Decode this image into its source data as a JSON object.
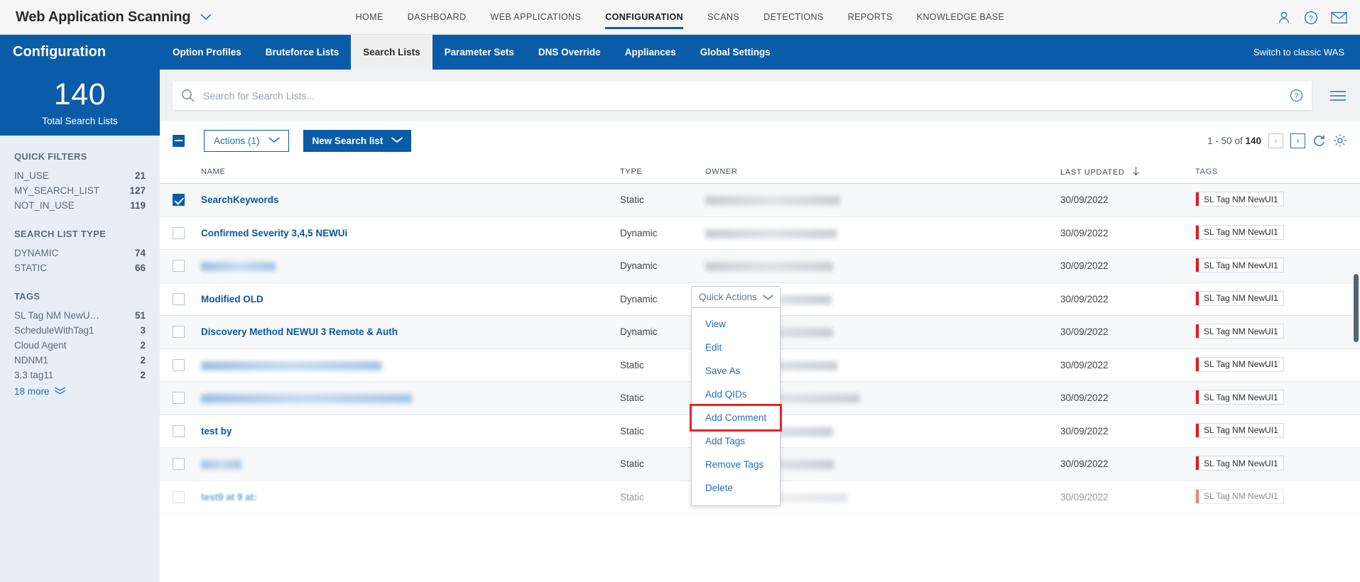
{
  "topbar": {
    "module_title": "Web Application Scanning",
    "module_caret": "chevron-down-icon",
    "nav": [
      {
        "label": "HOME",
        "active": false
      },
      {
        "label": "DASHBOARD",
        "active": false
      },
      {
        "label": "WEB APPLICATIONS",
        "active": false
      },
      {
        "label": "CONFIGURATION",
        "active": true
      },
      {
        "label": "SCANS",
        "active": false
      },
      {
        "label": "DETECTIONS",
        "active": false
      },
      {
        "label": "REPORTS",
        "active": false
      },
      {
        "label": "KNOWLEDGE BASE",
        "active": false
      }
    ],
    "icons": [
      "user-icon",
      "help-icon",
      "mail-icon"
    ]
  },
  "bluebar": {
    "section_title": "Configuration",
    "tabs": [
      {
        "label": "Option Profiles",
        "active": false
      },
      {
        "label": "Bruteforce Lists",
        "active": false
      },
      {
        "label": "Search Lists",
        "active": true
      },
      {
        "label": "Parameter Sets",
        "active": false
      },
      {
        "label": "DNS Override",
        "active": false
      },
      {
        "label": "Appliances",
        "active": false
      },
      {
        "label": "Global Settings",
        "active": false
      }
    ],
    "switch_classic": "Switch to classic WAS"
  },
  "sidebar": {
    "kpi_number": "140",
    "kpi_label": "Total Search Lists",
    "facets": [
      {
        "title": "QUICK FILTERS",
        "rows": [
          {
            "label": "IN_USE",
            "count": "21"
          },
          {
            "label": "MY_SEARCH_LIST",
            "count": "127"
          },
          {
            "label": "NOT_IN_USE",
            "count": "119"
          }
        ]
      },
      {
        "title": "SEARCH LIST TYPE",
        "rows": [
          {
            "label": "DYNAMIC",
            "count": "74"
          },
          {
            "label": "STATIC",
            "count": "66"
          }
        ]
      },
      {
        "title": "TAGS",
        "rows": [
          {
            "label": "SL Tag NM NewU…",
            "count": "51"
          },
          {
            "label": "ScheduleWithTag1",
            "count": "3"
          },
          {
            "label": "Cloud Agent",
            "count": "2"
          },
          {
            "label": "NDNM1",
            "count": "2"
          },
          {
            "label": "3.3 tag11",
            "count": "2"
          }
        ],
        "more_label": "18 more"
      }
    ]
  },
  "search": {
    "placeholder": "Search for Search Lists...",
    "value": "",
    "icon": "search-icon",
    "help_icon": "help-icon",
    "menu_icon": "hamburger-icon"
  },
  "toolbar": {
    "select_all": "indeterminate-checkbox",
    "actions_label": "Actions (1)",
    "new_label": "New Search list",
    "pager_text_prefix": "1 - 50 of ",
    "pager_total": "140",
    "prev_icon": "chevron-left-icon",
    "next_icon": "chevron-right-icon",
    "refresh_icon": "refresh-icon",
    "settings_icon": "gear-icon"
  },
  "table": {
    "columns": [
      "NAME",
      "TYPE",
      "OWNER",
      "LAST UPDATED",
      "TAGS"
    ],
    "sort_column": "LAST UPDATED",
    "sort_icon": "arrow-down-icon",
    "rows": [
      {
        "checked": true,
        "name": "SearchKeywords",
        "redacted": false,
        "name_w": 0,
        "type": "Static",
        "owner_w": 190,
        "date": "30/09/2022",
        "tag": "SL Tag NM NewUI1"
      },
      {
        "checked": false,
        "name": "Confirmed Severity 3,4,5 NEWUi",
        "redacted": false,
        "name_w": 0,
        "type": "Dynamic",
        "owner_w": 185,
        "date": "30/09/2022",
        "tag": "SL Tag NM NewUI1"
      },
      {
        "checked": false,
        "name": "",
        "redacted": true,
        "name_w": 105,
        "type": "Dynamic",
        "owner_w": 180,
        "date": "30/09/2022",
        "tag": "SL Tag NM NewUI1"
      },
      {
        "checked": false,
        "name": "Modified OLD",
        "redacted": false,
        "name_w": 0,
        "type": "Dynamic",
        "owner_w": 178,
        "date": "30/09/2022",
        "tag": "SL Tag NM NewUI1"
      },
      {
        "checked": false,
        "name": "Discovery Method NEWUI 3 Remote & Auth",
        "redacted": false,
        "name_w": 0,
        "type": "Dynamic",
        "owner_w": 180,
        "date": "30/09/2022",
        "tag": "SL Tag NM NewUI1"
      },
      {
        "checked": false,
        "name": "",
        "redacted": true,
        "name_w": 255,
        "bluish": true,
        "type": "Static",
        "owner_w": 186,
        "date": "30/09/2022",
        "tag": "SL Tag NM NewUI1"
      },
      {
        "checked": false,
        "name": "",
        "redacted": true,
        "name_w": 297,
        "type": "Static",
        "owner_w": 218,
        "date": "30/09/2022",
        "tag": "SL Tag NM NewUI1"
      },
      {
        "checked": false,
        "name": "test by",
        "redacted": false,
        "name_w": 0,
        "type": "Static",
        "owner_w": 180,
        "date": "30/09/2022",
        "tag": "SL Tag NM NewUI1"
      },
      {
        "checked": false,
        "name": "",
        "redacted": true,
        "name_w": 57,
        "bluish": true,
        "type": "Static",
        "owner_w": 182,
        "date": "30/09/2022",
        "tag": "SL Tag NM NewUI1"
      },
      {
        "checked": false,
        "name": "test9 at 9 at:",
        "redacted": true,
        "name_w": 0,
        "partial": true,
        "type": "Static",
        "owner_w": 200,
        "date": "30/09/2022",
        "tag": "SL Tag NM NewUI1"
      }
    ]
  },
  "quick_actions": {
    "header": "Quick Actions",
    "header_icon": "chevron-down-icon",
    "items": [
      {
        "label": "View",
        "highlighted": false
      },
      {
        "label": "Edit",
        "highlighted": false
      },
      {
        "label": "Save As",
        "highlighted": false
      },
      {
        "label": "Add QIDs",
        "highlighted": false
      },
      {
        "label": "Add Comment",
        "highlighted": true
      },
      {
        "label": "Add Tags",
        "highlighted": false
      },
      {
        "label": "Remove Tags",
        "highlighted": false
      },
      {
        "label": "Delete",
        "highlighted": false
      }
    ]
  },
  "colors": {
    "brand_blue": "#0b5ca8",
    "link_blue": "#2a6ebb",
    "highlight_red": "#e8232a",
    "tag_red": "#e01b24",
    "sidebar_bg": "#e8eef7"
  }
}
